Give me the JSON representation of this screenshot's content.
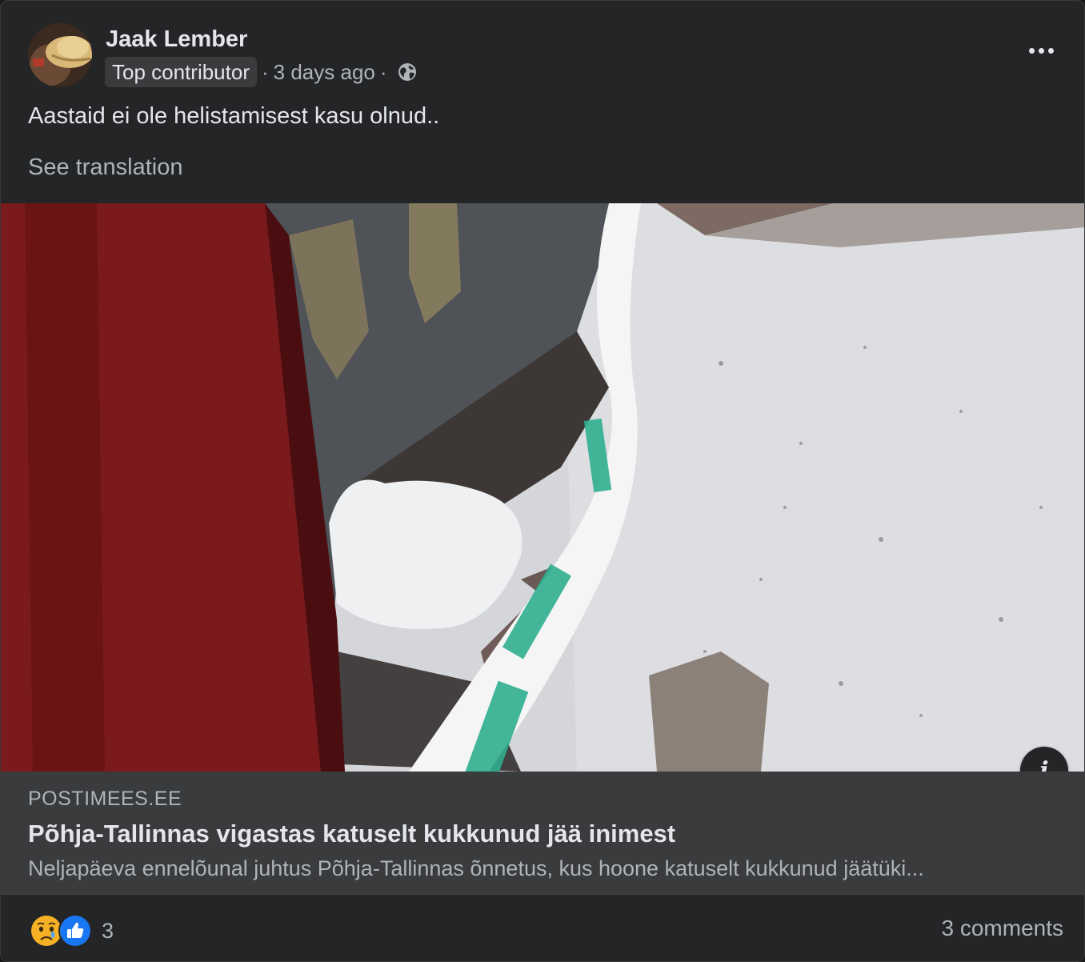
{
  "post": {
    "author": "Jaak Lember",
    "badge": "Top contributor",
    "time": "3 days ago",
    "separator": "·",
    "audience_icon": "globe-icon",
    "more_icon": "more-options-icon",
    "text": "Aastaid ei ole helistamisest kasu olnud..",
    "see_translation": "See translation"
  },
  "link": {
    "domain": "POSTIMEES.EE",
    "title": "Põhja-Tallinnas vigastas katuselt kukkunud jää inimest",
    "description": "Neljapäeva ennelõunal juhtus Põhja-Tallinnas õnnetus, kus hoone katuselt kukkunud jäätüki...",
    "info_icon": "info-icon",
    "info_label": "i"
  },
  "footer": {
    "reaction_icons": [
      "sad-reaction-icon",
      "like-reaction-icon"
    ],
    "reaction_count": "3",
    "comments": "3 comments"
  },
  "colors": {
    "background": "#242526",
    "link_bar": "#3a3b3c",
    "like_blue": "#1877f2",
    "sad_yellow": "#f7b125"
  }
}
